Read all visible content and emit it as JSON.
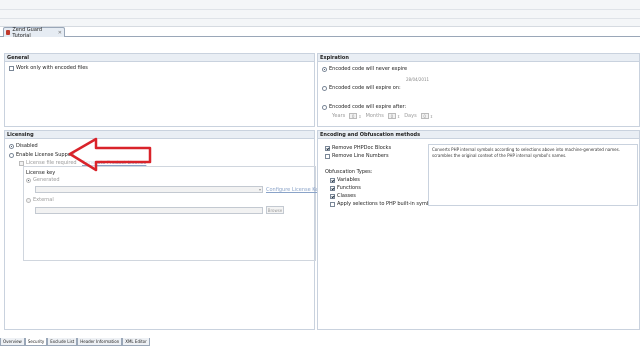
{
  "editor_tab": {
    "title": "Zend Guard Tutorial",
    "close": "✕"
  },
  "general": {
    "header": "General",
    "work_only_encoded": "Work only with encoded files"
  },
  "expiration": {
    "header": "Expiration",
    "never_expire": "Encoded code will never expire",
    "date_value": "28/04/2011",
    "expire_on": "Encoded code will expire on:",
    "expire_after": "Encoded code will expire after:",
    "years_label": "Years",
    "years_value": "0",
    "months_label": "Months",
    "months_value": "0",
    "days_label": "Days",
    "days_value": "0"
  },
  "licensing": {
    "header": "Licensing",
    "disabled": "Disabled",
    "enable_support": "Enable License Support",
    "license_file_required": "License file required",
    "generate_product_license": "Generate Product License",
    "license_key": "License key",
    "generated": "Generated",
    "configure_keys": "Configure License Keys",
    "external": "External",
    "browse": "Browse"
  },
  "encoding": {
    "header": "Encoding and Obfuscation methods",
    "remove_phpdoc": "Remove PHPDoc Blocks",
    "remove_line_numbers": "Remove Line Numbers",
    "obfuscation_types": "Obfuscation Types:",
    "variables": "Variables",
    "functions": "Functions",
    "classes": "Classes",
    "apply_builtin": "Apply selections to PHP built-in symbols",
    "description_line1": "Converts PHP internal symbols according to selections above into machine-generated names.",
    "description_line2": "scrambles the original context of the PHP internal symbol's names."
  },
  "bottom_tabs": [
    "Overview",
    "Security",
    "Exclude List",
    "Header Information",
    "XML Editor"
  ],
  "colors": {
    "arrow": "#d9232a",
    "section_header_bg": "#e9eef4"
  }
}
